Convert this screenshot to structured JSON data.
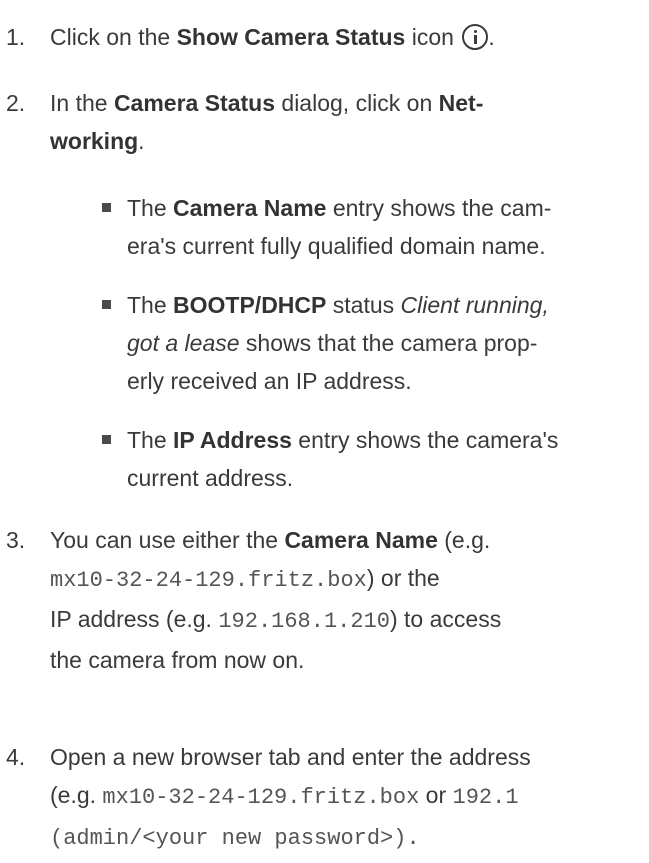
{
  "steps": [
    {
      "num": "1.",
      "lines": [
        [
          "Click on the ",
          "Show Camera Status",
          " icon "
        ]
      ],
      "icon": "info-circle-icon",
      "after_icon": "."
    },
    {
      "num": "2.",
      "l1a": "In the ",
      "l1b": "Camera Status",
      "l1c": " dialog, click on ",
      "l1d": "Net-",
      "l2a": "working",
      "l2b": "."
    },
    {
      "num": "3.",
      "l1a": "You can use either the ",
      "l1b": "Camera Name",
      "l1c": " (e.g.",
      "l2a": "mx10-32-24-129.fritz.box",
      "l2b": ") or the",
      "l3a": "IP address (e.g. ",
      "l3b": "192.168.1.210",
      "l3c": ") to access",
      "l4": "the camera from now on."
    },
    {
      "num": "4.",
      "l1": "Open a new browser tab and enter the address",
      "l2a": "(e.g. ",
      "l2b": "mx10-32-24-129.fritz.box",
      "l2c": " or ",
      "l2d": "192.1",
      "l3": "(admin/<your new password>)."
    }
  ],
  "bullets": [
    {
      "l1a": "The ",
      "l1b": "Camera Name",
      "l1c": " entry shows the cam-",
      "l2": "era's current fully qualified domain name."
    },
    {
      "l1a": "The ",
      "l1b": "BOOTP/DHCP",
      "l1c": " status ",
      "l1d": "Client running,",
      "l2a": "got a lease",
      "l2b": " shows that the camera prop-",
      "l3": "erly received an IP address."
    },
    {
      "l1a": "The ",
      "l1b": "IP Address",
      "l1c": " entry shows the camera's",
      "l2": "current address."
    }
  ]
}
